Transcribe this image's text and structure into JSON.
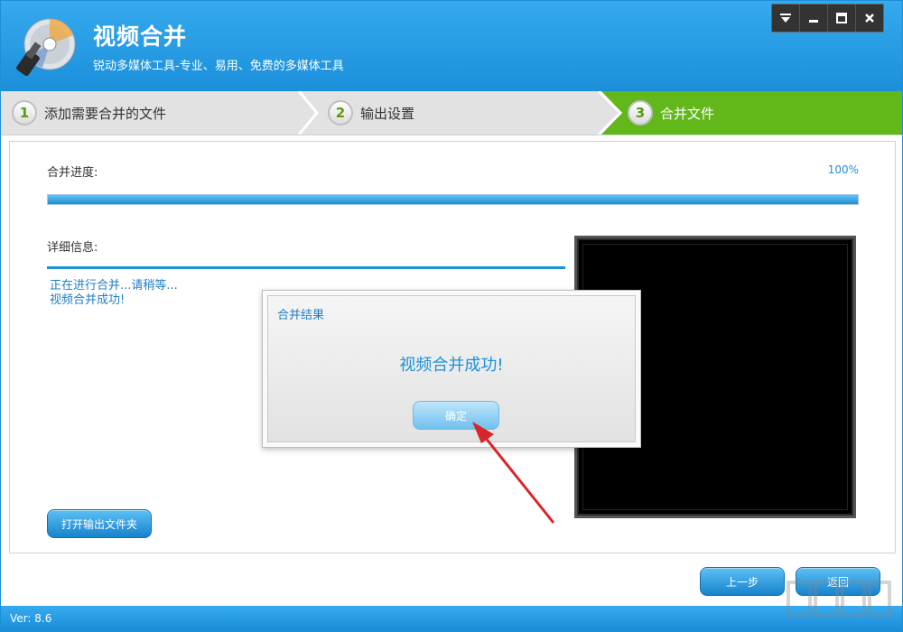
{
  "app": {
    "title": "视频合并",
    "subtitle": "锐动多媒体工具-专业、易用、免费的多媒体工具"
  },
  "window_controls": [
    "menu-icon",
    "minimize-icon",
    "maximize-icon",
    "close-icon"
  ],
  "steps": [
    {
      "number": "1",
      "label": "添加需要合并的文件",
      "active": false
    },
    {
      "number": "2",
      "label": "输出设置",
      "active": false
    },
    {
      "number": "3",
      "label": "合并文件",
      "active": true
    }
  ],
  "progress": {
    "label": "合并进度:",
    "percent_text": "100%",
    "value": 100
  },
  "details": {
    "label": "详细信息:",
    "lines": [
      "正在进行合并...请稍等...",
      "视频合并成功!"
    ]
  },
  "buttons": {
    "open_folder": "打开输出文件夹",
    "previous": "上一步",
    "back": "返回"
  },
  "dialog": {
    "title": "合并结果",
    "message": "视频合并成功!",
    "ok": "确定"
  },
  "status": {
    "version": "Ver: 8.6"
  },
  "colors": {
    "accent": "#1e90d6",
    "step_active": "#5fb516",
    "arrow": "#d9242a"
  }
}
